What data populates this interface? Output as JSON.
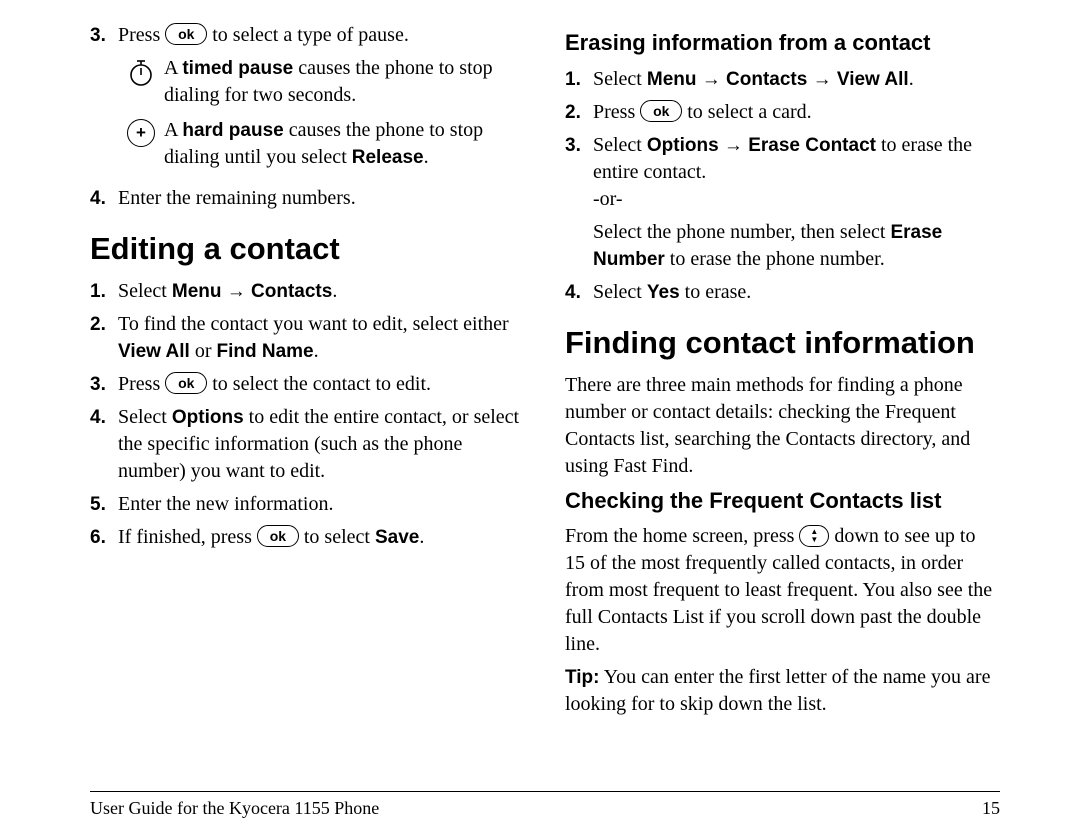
{
  "arrow": "→",
  "ok_label": "ok",
  "left": {
    "cont_step3_a": "Press ",
    "cont_step3_b": " to select a type of pause.",
    "pause_timed_a": "A ",
    "pause_timed_b": "timed pause",
    "pause_timed_c": " causes the phone to stop dialing for two seconds.",
    "pause_hard_a": "A ",
    "pause_hard_b": "hard pause",
    "pause_hard_c": " causes the phone to stop dialing until you select ",
    "pause_hard_d": "Release",
    "pause_hard_e": ".",
    "cont_step4": "Enter the remaining numbers.",
    "h_editing": "Editing a contact",
    "ed1_a": "Select ",
    "ed1_b": "Menu → Contacts",
    "ed1_c": ".",
    "ed2_a": "To find the contact you want to edit, select either ",
    "ed2_b": "View All",
    "ed2_c": " or ",
    "ed2_d": "Find Name",
    "ed2_e": ".",
    "ed3_a": "Press ",
    "ed3_b": " to select the contact to edit.",
    "ed4_a": "Select ",
    "ed4_b": "Options",
    "ed4_c": " to edit the entire contact, or select the specific information (such as the phone number) you want to edit.",
    "ed5": "Enter the new information.",
    "ed6_a": "If finished, press ",
    "ed6_b": " to select ",
    "ed6_c": "Save",
    "ed6_d": "."
  },
  "right": {
    "h_erasing": "Erasing information from a contact",
    "er1_a": "Select ",
    "er1_b": "Menu → Contacts → View All",
    "er1_c": ".",
    "er2_a": "Press ",
    "er2_b": " to select a card.",
    "er3_a": "Select ",
    "er3_b": "Options → Erase Contact",
    "er3_c": " to erase the entire contact.",
    "er3_or": "-or-",
    "er3_d": "Select the phone number, then select ",
    "er3_e": "Erase Number",
    "er3_f": " to erase the phone number.",
    "er4_a": "Select ",
    "er4_b": "Yes",
    "er4_c": " to erase.",
    "h_finding": "Finding contact information",
    "find_intro": "There are three main methods for finding a phone number or contact details: checking the Frequent Contacts list, searching the Contacts directory, and using Fast Find.",
    "h_checking": "Checking the Frequent Contacts list",
    "chk_a": "From the home screen, press ",
    "chk_b": " down to see up to 15 of the most frequently called contacts, in order from most frequent to least frequent. You also see the full Contacts List if you scroll down past the double line.",
    "tip_a": "Tip:",
    "tip_b": " You can enter the first letter of the name you are looking for to skip down the list."
  },
  "footer": {
    "title": "User Guide for the Kyocera 1155 Phone",
    "page": "15"
  }
}
